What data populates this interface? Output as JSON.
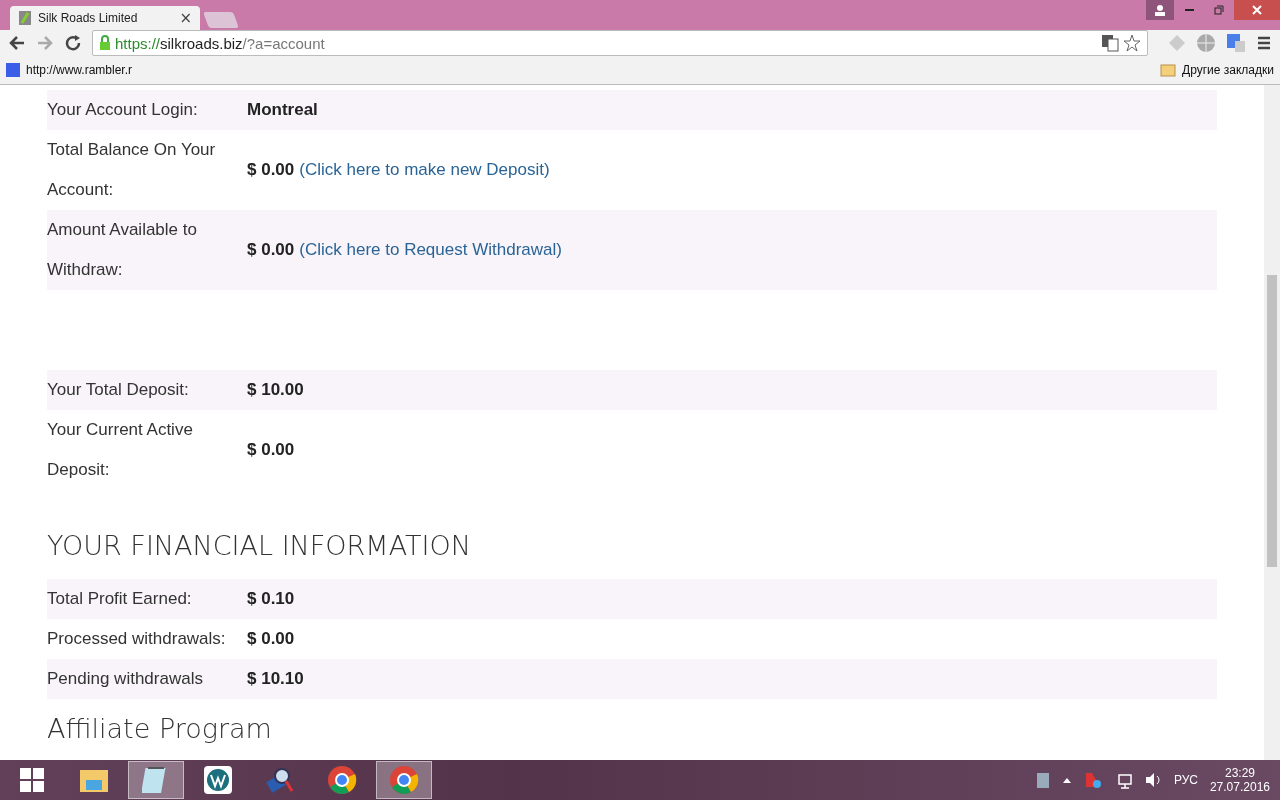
{
  "browser": {
    "tab_title": "Silk Roads Limited",
    "tab_close": "×",
    "url_scheme": "https://",
    "url_host": "silkroads.biz",
    "url_path": "/?a=account",
    "bookmarks": [
      {
        "label": "http://www.rambler.r"
      }
    ],
    "other_bookmarks": "Другие закладки"
  },
  "tables": [
    {
      "rows": [
        {
          "label": "Your Account Login:",
          "value": "Montreal"
        },
        {
          "label": "Total Balance On Your Account:",
          "value": "$ 0.00",
          "link": "(Click here to make new Deposit)"
        },
        {
          "label": "Amount Available to Withdraw:",
          "value": "$ 0.00",
          "link": "(Click here to Request Withdrawal)"
        }
      ]
    },
    {
      "rows": [
        {
          "label": "Your Total Deposit:",
          "value": "$ 10.00"
        },
        {
          "label": "Your Current Active Deposit:",
          "value": "$ 0.00"
        }
      ]
    }
  ],
  "financial": {
    "heading": "YOUR FINANCIAL INFORMATION",
    "rows": [
      {
        "label": "Total Profit Earned:",
        "value": "$ 0.10"
      },
      {
        "label": "Processed withdrawals:",
        "value": "$ 0.00"
      },
      {
        "label": "Pending withdrawals",
        "value": "$ 10.10"
      }
    ]
  },
  "next_heading": "Affiliate Program",
  "taskbar": {
    "apps": [
      {
        "kind": "explorer",
        "selected": false
      },
      {
        "kind": "notepad",
        "selected": true
      },
      {
        "kind": "wordpress",
        "selected": false
      },
      {
        "kind": "search",
        "selected": false
      },
      {
        "kind": "chrome",
        "selected": false
      },
      {
        "kind": "chrome",
        "selected": true
      }
    ],
    "language": "РУС",
    "time": "23:29",
    "date": "27.07.2016"
  }
}
